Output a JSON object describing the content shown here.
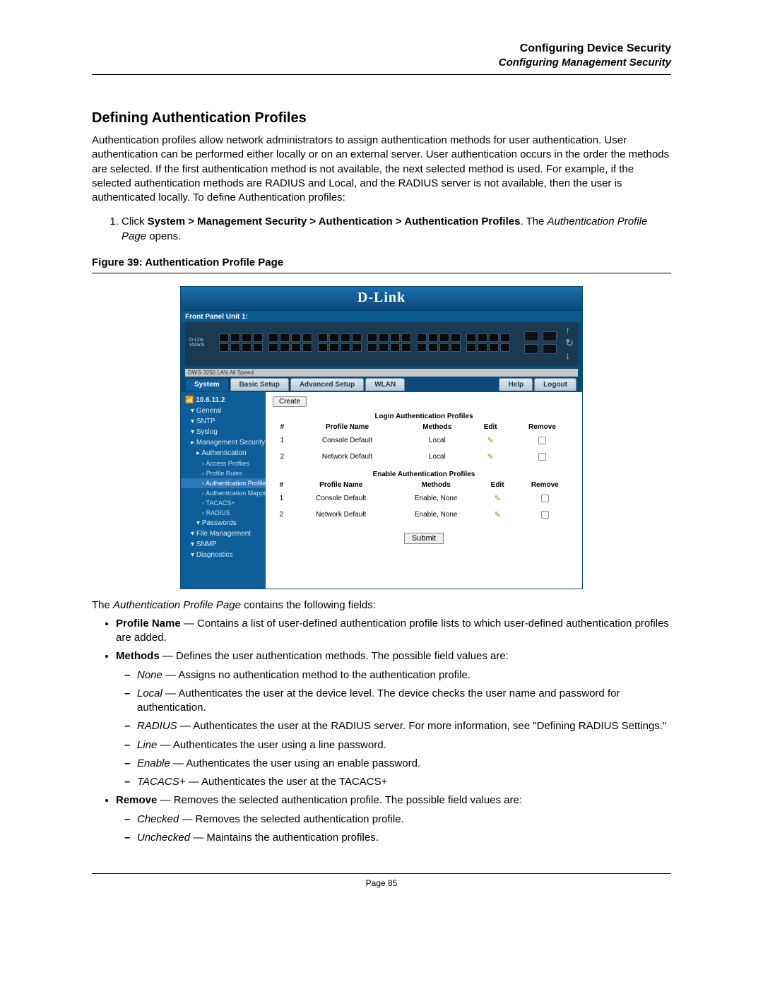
{
  "header": {
    "main": "Configuring Device Security",
    "sub": "Configuring Management Security"
  },
  "section": {
    "title": "Defining Authentication Profiles",
    "intro": "Authentication profiles allow network administrators to assign authentication methods for user authentication. User authentication can be performed either locally or on an external server. User authentication occurs in the order the methods are selected. If the first authentication method is not available, the next selected method is used. For example, if the selected authentication methods are RADIUS and Local, and the RADIUS server is not available, then the user is authenticated locally. To define Authentication profiles:",
    "step1_prefix": "Click ",
    "step1_bold": "System > Management Security > Authentication > Authentication Profiles",
    "step1_mid": ". The ",
    "step1_italic": "Authentication Profile Page",
    "step1_suffix": " opens."
  },
  "figure": {
    "caption": "Figure 39:  Authentication Profile Page"
  },
  "shot": {
    "brand": "D-Link",
    "frontpanel": "Front Panel Unit 1:",
    "dev_label_1": "D-Link",
    "dev_label_2": "xStack",
    "stripe": "DWS-3250   LAN  All Speed",
    "tabs": {
      "system": "System",
      "basic": "Basic Setup",
      "adv": "Advanced Setup",
      "wlan": "WLAN",
      "help": "Help",
      "logout": "Logout"
    },
    "sidebar": {
      "ip": "10.6.11.2",
      "items": [
        "General",
        "SNTP",
        "Syslog",
        "Management Security",
        "Authentication",
        "Access Profiles",
        "Profile Rules",
        "Authentication Profiles",
        "Authentication Mapping",
        "TACACS+",
        "RADIUS",
        "Passwords",
        "File Management",
        "SNMP",
        "Diagnostics"
      ]
    },
    "create": "Create",
    "table1": {
      "title": "Login Authentication Profiles",
      "cols": [
        "#",
        "Profile Name",
        "Methods",
        "Edit",
        "Remove"
      ],
      "rows": [
        {
          "n": "1",
          "name": "Console Default",
          "methods": "Local"
        },
        {
          "n": "2",
          "name": "Network Default",
          "methods": "Local"
        }
      ]
    },
    "table2": {
      "title": "Enable Authentication Profiles",
      "cols": [
        "#",
        "Profile Name",
        "Methods",
        "Edit",
        "Remove"
      ],
      "rows": [
        {
          "n": "1",
          "name": "Console Default",
          "methods": "Enable, None"
        },
        {
          "n": "2",
          "name": "Network Default",
          "methods": "Enable, None"
        }
      ]
    },
    "submit": "Submit"
  },
  "after": {
    "lead_pre": "The ",
    "lead_italic": "Authentication Profile Page",
    "lead_post": " contains the following fields:",
    "fields": {
      "profile_label": "Profile Name",
      "profile_desc": " — Contains a list of user-defined authentication profile lists to which user-defined authentication profiles are added.",
      "methods_label": "Methods",
      "methods_desc": " — Defines the user authentication methods. The possible field values are:",
      "methods_items": [
        {
          "term": "None",
          "desc": " — Assigns no authentication method to the authentication profile."
        },
        {
          "term": "Local",
          "desc": " — Authenticates the user at the device level. The device checks the user name and password for authentication."
        },
        {
          "term": "RADIUS",
          "desc": " — Authenticates the user at the RADIUS server. For more information, see \"Defining RADIUS Settings.\""
        },
        {
          "term": "Line",
          "desc": " — Authenticates the user using a line password."
        },
        {
          "term": "Enable",
          "desc": " — Authenticates the user using an enable password."
        },
        {
          "term": "TACACS+",
          "desc": " — Authenticates the user at the TACACS+"
        }
      ],
      "remove_label": "Remove",
      "remove_desc": " — Removes the selected authentication profile. The possible field values are:",
      "remove_items": [
        {
          "term": "Checked",
          "desc": " — Removes the selected authentication profile."
        },
        {
          "term": "Unchecked",
          "desc": " — Maintains the authentication profiles."
        }
      ]
    }
  },
  "footer": {
    "page": "Page 85"
  }
}
